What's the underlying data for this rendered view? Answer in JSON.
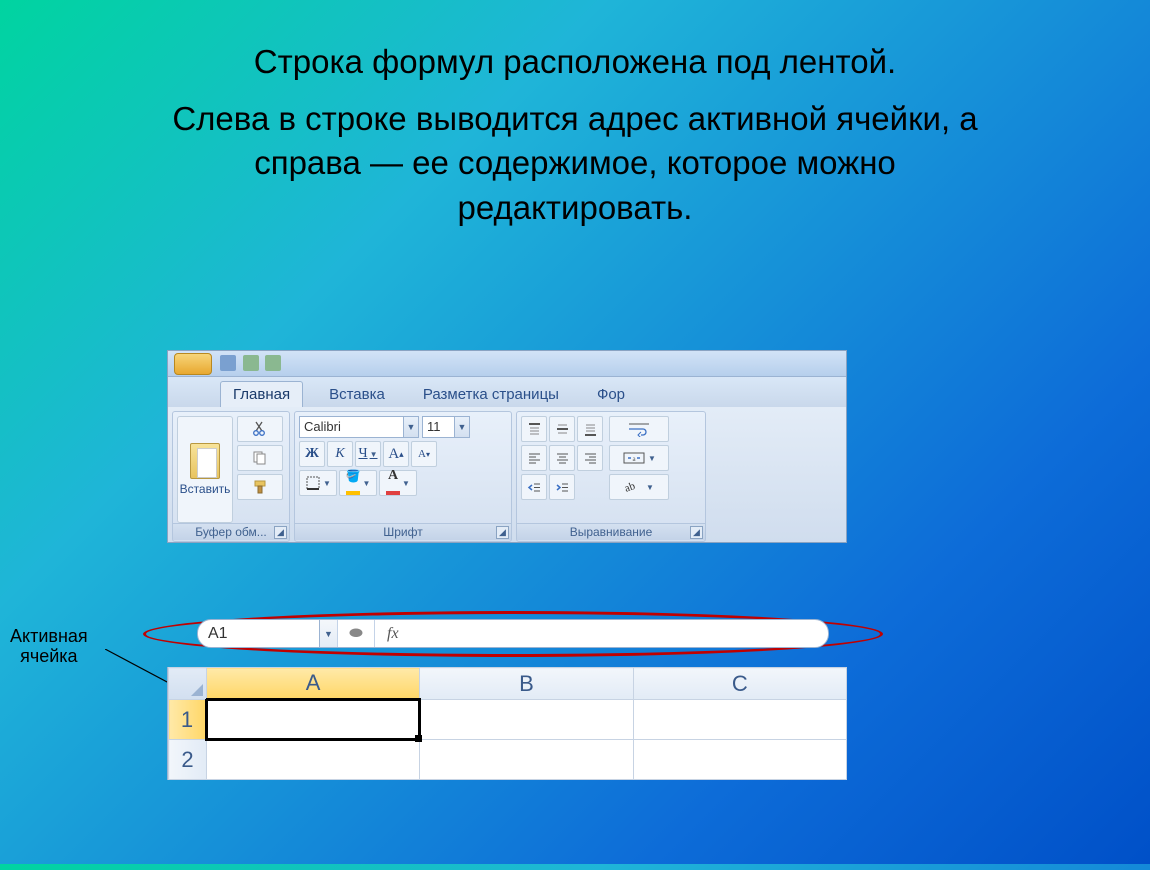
{
  "slide": {
    "line1": "Строка формул расположена под лентой.",
    "line2": "Слева в строке выводится адрес активной ячейки, а справа — ее содержимое, которое можно редактировать."
  },
  "annotation": {
    "l1": "Активная",
    "l2": "ячейка"
  },
  "tabs": {
    "home": "Главная",
    "insert": "Вставка",
    "layout": "Разметка страницы",
    "formulas": "Фор"
  },
  "clipboard": {
    "paste": "Вставить",
    "group": "Буфер обм..."
  },
  "font": {
    "name": "Calibri",
    "size": "11",
    "bold": "Ж",
    "italic": "К",
    "underline": "Ч",
    "group": "Шрифт",
    "letterA": "A"
  },
  "align": {
    "group": "Выравнивание"
  },
  "formula_bar": {
    "namebox": "A1",
    "fx": "fx"
  },
  "columns": {
    "A": "A",
    "B": "B",
    "C": "C"
  },
  "rows": {
    "r1": "1",
    "r2": "2"
  }
}
